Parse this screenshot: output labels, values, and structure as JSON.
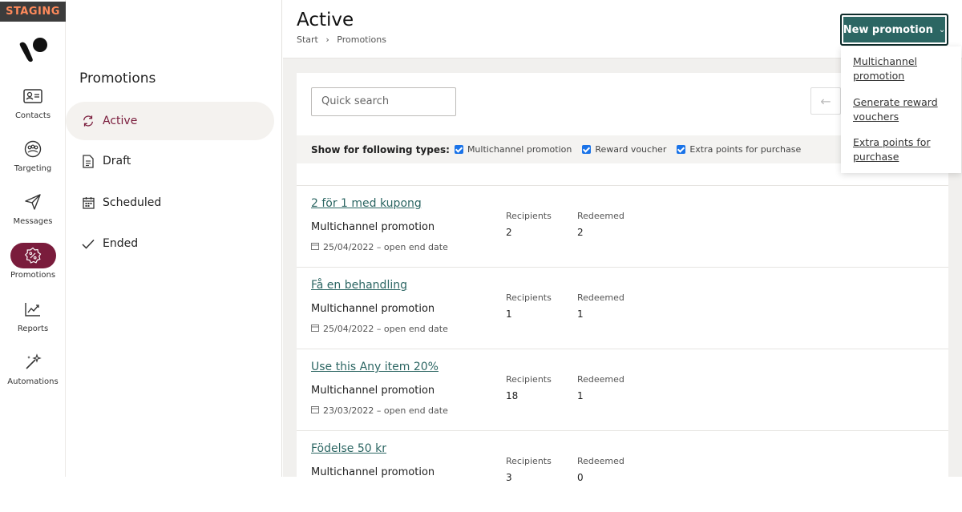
{
  "env_badge": "STAGING",
  "rail": {
    "items": [
      {
        "label": "Contacts",
        "icon": "contact-card-icon"
      },
      {
        "label": "Targeting",
        "icon": "audience-icon"
      },
      {
        "label": "Messages",
        "icon": "paper-plane-icon"
      },
      {
        "label": "Promotions",
        "icon": "percent-badge-icon",
        "active": true
      },
      {
        "label": "Reports",
        "icon": "chart-line-icon"
      },
      {
        "label": "Automations",
        "icon": "magic-wand-icon"
      }
    ]
  },
  "subnav": {
    "title": "Promotions",
    "items": [
      {
        "label": "Active",
        "icon": "refresh-icon",
        "active": true
      },
      {
        "label": "Draft",
        "icon": "document-icon"
      },
      {
        "label": "Scheduled",
        "icon": "calendar-icon"
      },
      {
        "label": "Ended",
        "icon": "check-icon"
      }
    ]
  },
  "header": {
    "title": "Active",
    "breadcrumb": [
      "Start",
      "Promotions"
    ],
    "new_button": "New promotion"
  },
  "search": {
    "placeholder": "Quick search"
  },
  "filters": {
    "label": "Show for following types:",
    "options": [
      {
        "label": "Multichannel promotion",
        "checked": true
      },
      {
        "label": "Reward voucher",
        "checked": true
      },
      {
        "label": "Extra points for purchase",
        "checked": true
      }
    ]
  },
  "stat_labels": {
    "recipients": "Recipients",
    "redeemed": "Redeemed"
  },
  "promotions": [
    {
      "title": "2 för 1 med kupong",
      "type": "Multichannel promotion",
      "date": "25/04/2022 – open end date",
      "recipients": "2",
      "redeemed": "2"
    },
    {
      "title": "Få en behandling",
      "type": "Multichannel promotion",
      "date": "25/04/2022 – open end date",
      "recipients": "1",
      "redeemed": "1"
    },
    {
      "title": "Use this Any item 20%",
      "type": "Multichannel promotion",
      "date": "23/03/2022 – open end date",
      "recipients": "18",
      "redeemed": "1"
    },
    {
      "title": "Födelse 50 kr",
      "type": "Multichannel promotion",
      "date": "",
      "recipients": "3",
      "redeemed": "0"
    }
  ],
  "dropdown": {
    "items": [
      {
        "line1": "Multichannel",
        "line2": "promotion"
      },
      {
        "line1": "Generate reward",
        "line2": "vouchers"
      },
      {
        "line1": "Extra points for",
        "line2": "purchase"
      }
    ]
  },
  "colors": {
    "brand": "#7a1c3c",
    "accent": "#2c6663",
    "staging": "#ff8a5b"
  }
}
